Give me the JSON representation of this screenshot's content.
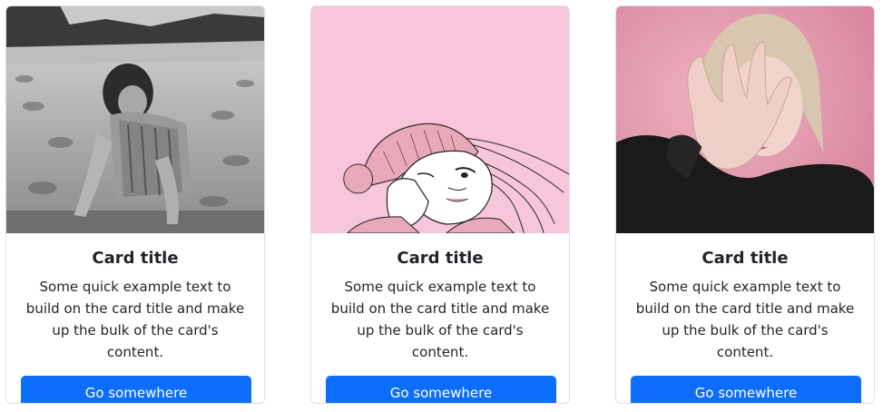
{
  "cards": [
    {
      "image": "girl-on-beach-photo",
      "title": "Card title",
      "text": "Some quick example text to build on the card title and make up the bulk of the card's content.",
      "button_label": "Go somewhere"
    },
    {
      "image": "girl-illustration",
      "title": "Card title",
      "text": "Some quick example text to build on the card title and make up the bulk of the card's content.",
      "button_label": "Go somewhere"
    },
    {
      "image": "woman-hand-over-face-photo",
      "title": "Card title",
      "text": "Some quick example text to build on the card title and make up the bulk of the card's content.",
      "button_label": "Go somewhere"
    }
  ],
  "colors": {
    "button": "#0d6efd",
    "card_border": "#dcdfe3",
    "illustration_bg": "#f7c6da"
  }
}
